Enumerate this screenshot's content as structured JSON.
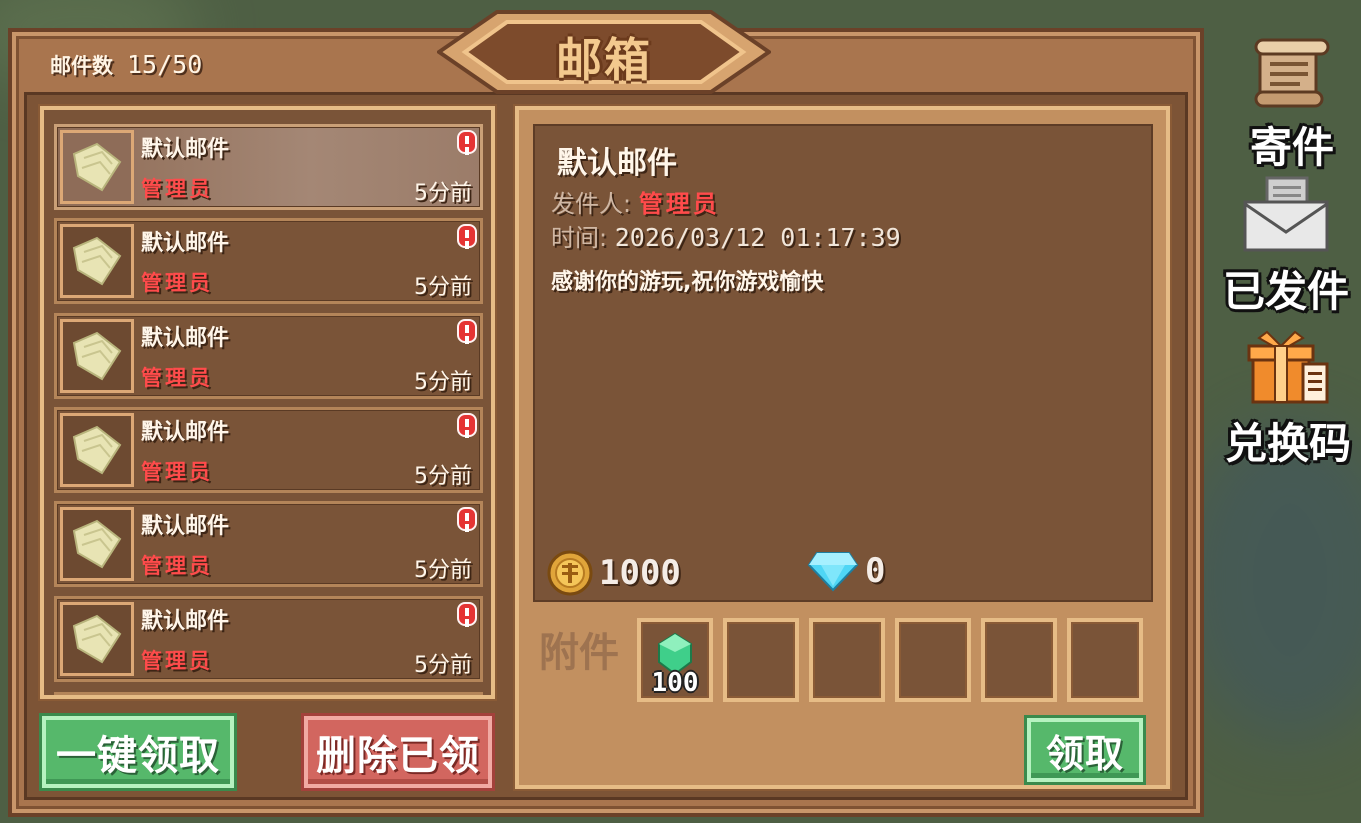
{
  "title": "邮箱",
  "mail_count": {
    "label": "邮件数",
    "value": "15/50"
  },
  "mail_list": [
    {
      "title": "默认邮件",
      "sender": "管理员",
      "time": "5分前",
      "unread": true,
      "selected": true
    },
    {
      "title": "默认邮件",
      "sender": "管理员",
      "time": "5分前",
      "unread": true,
      "selected": false
    },
    {
      "title": "默认邮件",
      "sender": "管理员",
      "time": "5分前",
      "unread": true,
      "selected": false
    },
    {
      "title": "默认邮件",
      "sender": "管理员",
      "time": "5分前",
      "unread": true,
      "selected": false
    },
    {
      "title": "默认邮件",
      "sender": "管理员",
      "time": "5分前",
      "unread": true,
      "selected": false
    },
    {
      "title": "默认邮件",
      "sender": "管理员",
      "time": "5分前",
      "unread": true,
      "selected": false
    }
  ],
  "buttons": {
    "claim_all": "一键领取",
    "delete_claimed": "删除已领",
    "claim": "领取"
  },
  "detail": {
    "title": "默认邮件",
    "sender_label": "发件人:",
    "sender": "管理员",
    "time_label": "时间:",
    "time": "2026/03/12 01:17:39",
    "content": "感谢你的游玩,祝你游戏愉快",
    "rewards": {
      "gold": "1000",
      "diamond": "0"
    },
    "attach_label": "附件",
    "attachments": [
      {
        "icon": "emerald-icon",
        "count": "100"
      }
    ],
    "empty_slots": 5
  },
  "side_menu": [
    {
      "label": "寄件",
      "icon": "scroll-icon"
    },
    {
      "label": "已发件",
      "icon": "envelope-icon"
    },
    {
      "label": "兑换码",
      "icon": "gift-icon"
    }
  ],
  "colors": {
    "panel": "#a9754e",
    "accent_green": "#56b86b",
    "accent_red": "#d2665f",
    "sender_red": "#ff4b4b"
  }
}
